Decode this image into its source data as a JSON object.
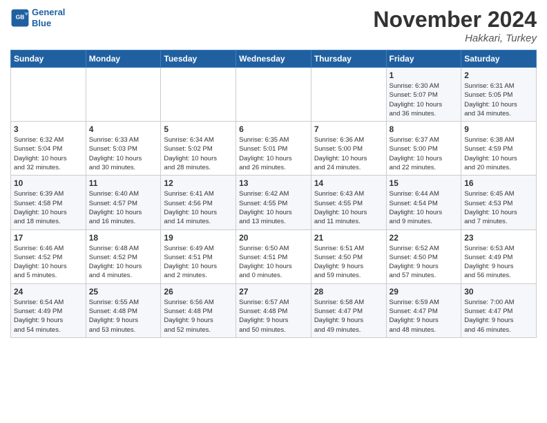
{
  "header": {
    "logo_line1": "General",
    "logo_line2": "Blue",
    "month": "November 2024",
    "location": "Hakkari, Turkey"
  },
  "days_of_week": [
    "Sunday",
    "Monday",
    "Tuesday",
    "Wednesday",
    "Thursday",
    "Friday",
    "Saturday"
  ],
  "weeks": [
    [
      {
        "day": "",
        "info": ""
      },
      {
        "day": "",
        "info": ""
      },
      {
        "day": "",
        "info": ""
      },
      {
        "day": "",
        "info": ""
      },
      {
        "day": "",
        "info": ""
      },
      {
        "day": "1",
        "info": "Sunrise: 6:30 AM\nSunset: 5:07 PM\nDaylight: 10 hours\nand 36 minutes."
      },
      {
        "day": "2",
        "info": "Sunrise: 6:31 AM\nSunset: 5:05 PM\nDaylight: 10 hours\nand 34 minutes."
      }
    ],
    [
      {
        "day": "3",
        "info": "Sunrise: 6:32 AM\nSunset: 5:04 PM\nDaylight: 10 hours\nand 32 minutes."
      },
      {
        "day": "4",
        "info": "Sunrise: 6:33 AM\nSunset: 5:03 PM\nDaylight: 10 hours\nand 30 minutes."
      },
      {
        "day": "5",
        "info": "Sunrise: 6:34 AM\nSunset: 5:02 PM\nDaylight: 10 hours\nand 28 minutes."
      },
      {
        "day": "6",
        "info": "Sunrise: 6:35 AM\nSunset: 5:01 PM\nDaylight: 10 hours\nand 26 minutes."
      },
      {
        "day": "7",
        "info": "Sunrise: 6:36 AM\nSunset: 5:00 PM\nDaylight: 10 hours\nand 24 minutes."
      },
      {
        "day": "8",
        "info": "Sunrise: 6:37 AM\nSunset: 5:00 PM\nDaylight: 10 hours\nand 22 minutes."
      },
      {
        "day": "9",
        "info": "Sunrise: 6:38 AM\nSunset: 4:59 PM\nDaylight: 10 hours\nand 20 minutes."
      }
    ],
    [
      {
        "day": "10",
        "info": "Sunrise: 6:39 AM\nSunset: 4:58 PM\nDaylight: 10 hours\nand 18 minutes."
      },
      {
        "day": "11",
        "info": "Sunrise: 6:40 AM\nSunset: 4:57 PM\nDaylight: 10 hours\nand 16 minutes."
      },
      {
        "day": "12",
        "info": "Sunrise: 6:41 AM\nSunset: 4:56 PM\nDaylight: 10 hours\nand 14 minutes."
      },
      {
        "day": "13",
        "info": "Sunrise: 6:42 AM\nSunset: 4:55 PM\nDaylight: 10 hours\nand 13 minutes."
      },
      {
        "day": "14",
        "info": "Sunrise: 6:43 AM\nSunset: 4:55 PM\nDaylight: 10 hours\nand 11 minutes."
      },
      {
        "day": "15",
        "info": "Sunrise: 6:44 AM\nSunset: 4:54 PM\nDaylight: 10 hours\nand 9 minutes."
      },
      {
        "day": "16",
        "info": "Sunrise: 6:45 AM\nSunset: 4:53 PM\nDaylight: 10 hours\nand 7 minutes."
      }
    ],
    [
      {
        "day": "17",
        "info": "Sunrise: 6:46 AM\nSunset: 4:52 PM\nDaylight: 10 hours\nand 5 minutes."
      },
      {
        "day": "18",
        "info": "Sunrise: 6:48 AM\nSunset: 4:52 PM\nDaylight: 10 hours\nand 4 minutes."
      },
      {
        "day": "19",
        "info": "Sunrise: 6:49 AM\nSunset: 4:51 PM\nDaylight: 10 hours\nand 2 minutes."
      },
      {
        "day": "20",
        "info": "Sunrise: 6:50 AM\nSunset: 4:51 PM\nDaylight: 10 hours\nand 0 minutes."
      },
      {
        "day": "21",
        "info": "Sunrise: 6:51 AM\nSunset: 4:50 PM\nDaylight: 9 hours\nand 59 minutes."
      },
      {
        "day": "22",
        "info": "Sunrise: 6:52 AM\nSunset: 4:50 PM\nDaylight: 9 hours\nand 57 minutes."
      },
      {
        "day": "23",
        "info": "Sunrise: 6:53 AM\nSunset: 4:49 PM\nDaylight: 9 hours\nand 56 minutes."
      }
    ],
    [
      {
        "day": "24",
        "info": "Sunrise: 6:54 AM\nSunset: 4:49 PM\nDaylight: 9 hours\nand 54 minutes."
      },
      {
        "day": "25",
        "info": "Sunrise: 6:55 AM\nSunset: 4:48 PM\nDaylight: 9 hours\nand 53 minutes."
      },
      {
        "day": "26",
        "info": "Sunrise: 6:56 AM\nSunset: 4:48 PM\nDaylight: 9 hours\nand 52 minutes."
      },
      {
        "day": "27",
        "info": "Sunrise: 6:57 AM\nSunset: 4:48 PM\nDaylight: 9 hours\nand 50 minutes."
      },
      {
        "day": "28",
        "info": "Sunrise: 6:58 AM\nSunset: 4:47 PM\nDaylight: 9 hours\nand 49 minutes."
      },
      {
        "day": "29",
        "info": "Sunrise: 6:59 AM\nSunset: 4:47 PM\nDaylight: 9 hours\nand 48 minutes."
      },
      {
        "day": "30",
        "info": "Sunrise: 7:00 AM\nSunset: 4:47 PM\nDaylight: 9 hours\nand 46 minutes."
      }
    ]
  ]
}
